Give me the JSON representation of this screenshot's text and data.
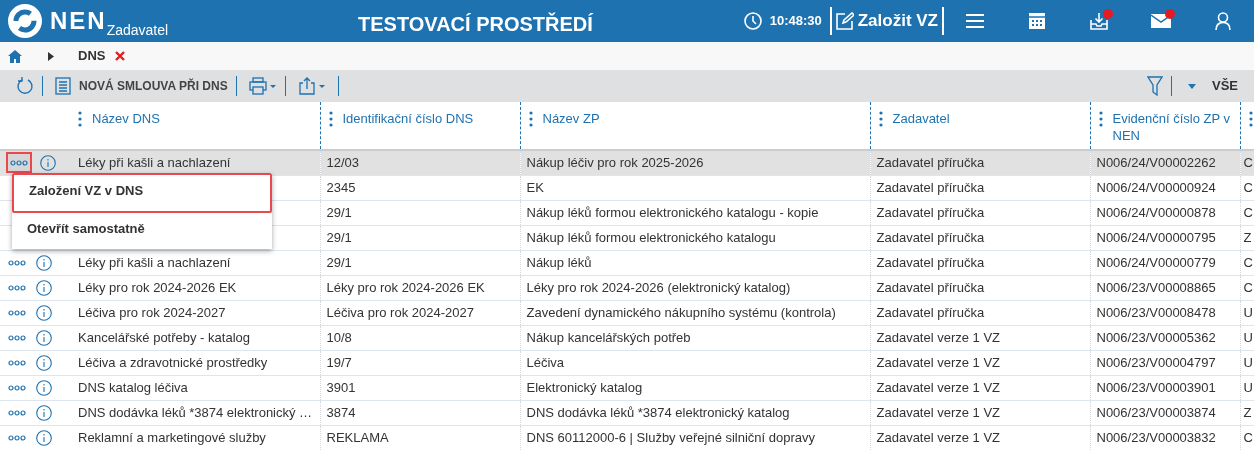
{
  "header": {
    "logo": "NEN",
    "subtitle": "Zadavatel",
    "title": "TESTOVACÍ PROSTŘEDÍ",
    "time": "10:48:30",
    "create_button": "Založit VZ",
    "notifications": [
      {
        "kind": "menu",
        "badge": false
      },
      {
        "kind": "calendar",
        "badge": false
      },
      {
        "kind": "inbox",
        "badge": true
      },
      {
        "kind": "mail",
        "badge": true
      },
      {
        "kind": "user",
        "badge": false
      }
    ]
  },
  "breadcrumb": {
    "items": [
      "DNS"
    ]
  },
  "toolbar": {
    "new_button": "NOVÁ SMLOUVA PŘI DNS",
    "filter_label": "VŠE"
  },
  "table": {
    "columns": [
      "Název DNS",
      "Identifikační číslo DNS",
      "Název ZP",
      "Zadavatel",
      "Evidenční číslo ZP v NEN"
    ],
    "rows": [
      {
        "selected": true,
        "actions_hidden": false,
        "cells": [
          "Léky při kašli a nachlazení",
          "12/03",
          "Nákup léčiv pro rok 2025-2026",
          "Zadavatel příručka",
          "N006/24/V00002262",
          "C"
        ]
      },
      {
        "selected": false,
        "actions_hidden": true,
        "cells": [
          null,
          "2345",
          "EK",
          "Zadavatel příručka",
          "N006/24/V00000924",
          "C"
        ]
      },
      {
        "selected": false,
        "actions_hidden": true,
        "cells": [
          null,
          "29/1",
          "Nákup léků formou elektronického katalogu - kopie",
          "Zadavatel příručka",
          "N006/24/V00000878",
          "C"
        ]
      },
      {
        "selected": false,
        "actions_hidden": true,
        "cells": [
          null,
          "29/1",
          "Nákup léků formou elektronického katalogu",
          "Zadavatel příručka",
          "N006/24/V00000795",
          "Z"
        ]
      },
      {
        "selected": false,
        "actions_hidden": false,
        "cells": [
          "Léky při kašli a nachlazení",
          "29/1",
          "Nákup léků",
          "Zadavatel příručka",
          "N006/24/V00000779",
          "C"
        ]
      },
      {
        "selected": false,
        "actions_hidden": false,
        "cells": [
          "Léky pro rok 2024-2026 EK",
          "Léky pro rok 2024-2026 EK",
          "Léky pro rok 2024-2026 (elektronický katalog)",
          "Zadavatel příručka",
          "N006/23/V00008865",
          "C"
        ]
      },
      {
        "selected": false,
        "actions_hidden": false,
        "cells": [
          "Léčiva pro rok 2024-2027",
          "Léčiva pro rok 2024-2027",
          "Zavedení dynamického nákupního systému (kontrola)",
          "Zadavatel příručka",
          "N006/23/V00008478",
          "U"
        ]
      },
      {
        "selected": false,
        "actions_hidden": false,
        "cells": [
          "Kancelářské potřeby - katalog",
          "10/8",
          "Nákup kancelářských potřeb",
          "Zadavatel verze 1 VZ",
          "N006/23/V00005362",
          "U"
        ]
      },
      {
        "selected": false,
        "actions_hidden": false,
        "cells": [
          "Léčiva a zdravotnické prostředky",
          "19/7",
          "Léčiva",
          "Zadavatel verze 1 VZ",
          "N006/23/V00004797",
          "U"
        ]
      },
      {
        "selected": false,
        "actions_hidden": false,
        "cells": [
          "DNS katalog léčiva",
          "3901",
          "Elektronický katalog",
          "Zadavatel verze 1 VZ",
          "N006/23/V00003901",
          "U"
        ]
      },
      {
        "selected": false,
        "actions_hidden": false,
        "cells": [
          "DNS dodávka léků *3874 elektronický …",
          "3874",
          "DNS dodávka léků *3874 elektronický katalog",
          "Zadavatel verze 1 VZ",
          "N006/23/V00003874",
          "Z"
        ]
      },
      {
        "selected": false,
        "actions_hidden": false,
        "cells": [
          "Reklamní a marketingové služby",
          "REKLAMA",
          "DNS 60112000-6 | Služby veřejné silniční dopravy",
          "Zadavatel verze 1 VZ",
          "N006/23/V00003832",
          "C"
        ]
      }
    ]
  },
  "context_menu": {
    "items": [
      {
        "label": "Založení VZ v DNS",
        "highlighted": true
      },
      {
        "label": "Otevřít samostatně",
        "highlighted": false
      }
    ]
  }
}
